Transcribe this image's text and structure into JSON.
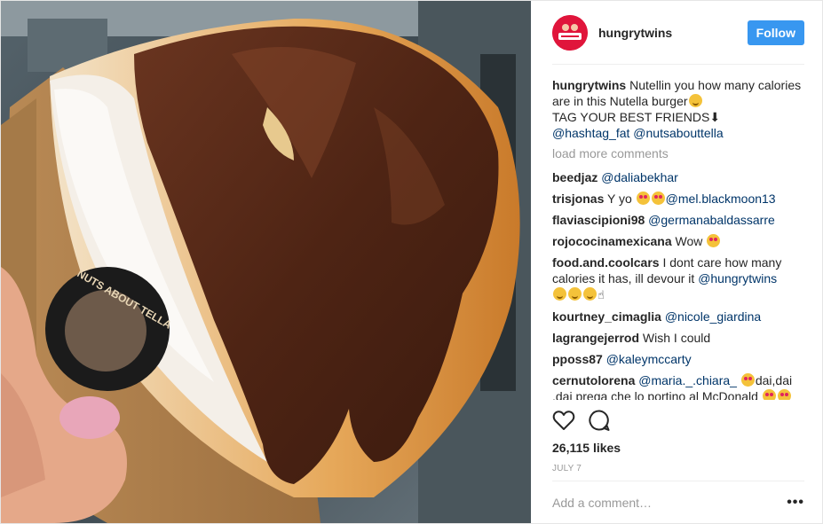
{
  "post": {
    "username": "hungrytwins",
    "follow_label": "Follow",
    "caption": {
      "username": "hungrytwins",
      "text": "Nutellin you how many calories are in this Nutella burger",
      "line2": "TAG YOUR BEST FRIENDS⬇",
      "mention1": "@hashtag_fat",
      "mention2": "@nutsabouttella"
    },
    "load_more": "load more comments",
    "comments": [
      {
        "user": "beedjaz",
        "mention": "@daliabekhar"
      },
      {
        "user": "trisjonas",
        "text": "Y yo",
        "mention": "@mel.blackmoon13"
      },
      {
        "user": "flaviascipioni98",
        "mention": "@germanabaldassarre"
      },
      {
        "user": "rojococinamexicana",
        "text": "Wow"
      },
      {
        "user": "food.and.coolcars",
        "text": "I dont care how many calories it has, ill devour it",
        "mention": "@hungrytwins"
      },
      {
        "user": "kourtney_cimaglia",
        "mention": "@nicole_giardina"
      },
      {
        "user": "lagrangejerrod",
        "text": "Wish I could"
      },
      {
        "user": "pposs87",
        "mention": "@kaleymccarty"
      },
      {
        "user": "cernutolorena",
        "mention": "@maria._.chiara_",
        "text": "dai,dai ,dai prega che lo portino al McDonald"
      }
    ],
    "likes": "26,115 likes",
    "date": "JULY 7",
    "add_comment_placeholder": "Add a comment…",
    "more_options": "•••",
    "photo_box_text": "NUTS ABOUT TELLA"
  },
  "icons": {
    "like": "heart-outline-icon",
    "comment": "speech-bubble-icon",
    "more": "ellipsis-icon"
  },
  "colors": {
    "follow_blue": "#3897f0",
    "mention_navy": "#003569",
    "muted_grey": "#999999",
    "text": "#262626",
    "avatar_red": "#e0153b"
  }
}
